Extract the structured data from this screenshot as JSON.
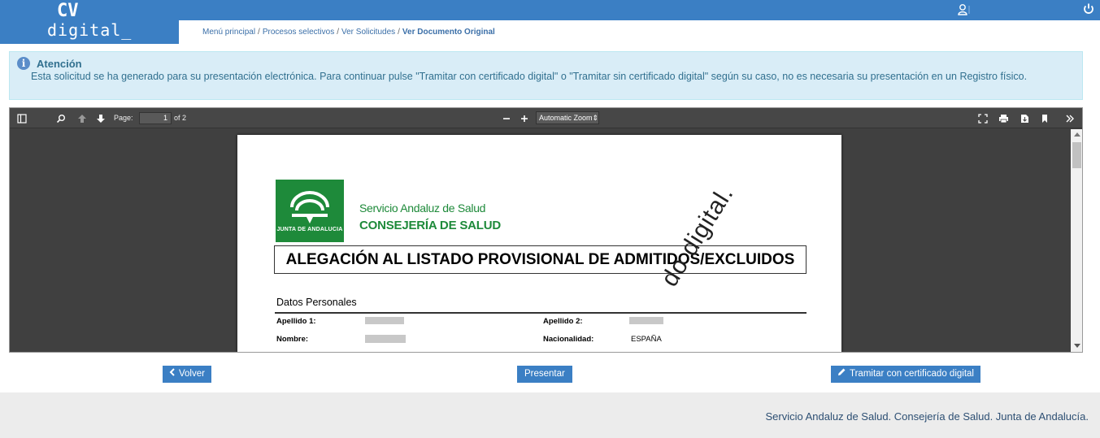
{
  "header": {
    "logo_line1": "CV",
    "logo_line2": "digital_",
    "brand_color": "#3b7fc4"
  },
  "breadcrumb": {
    "items": [
      "Menú principal",
      "Procesos selectivos",
      "Ver Solicitudes"
    ],
    "current": "Ver Documento Original",
    "separator": "/"
  },
  "alert": {
    "title": "Atención",
    "text": "Esta solicitud se ha generado para su presentación electrónica. Para continuar pulse \"Tramitar con certificado digital\" o \"Tramitar sin certificado digital\" según su caso, no es necesaria su presentación en un Registro físico.",
    "background": "#d9edf7"
  },
  "pdf_viewer": {
    "page_label": "Page:",
    "page_value": "1",
    "page_of": "of 2",
    "zoom": "Automatic Zoom",
    "icons": [
      "sidebar-toggle-icon",
      "find-icon",
      "previous-page-icon",
      "next-page-icon",
      "zoom-out-icon",
      "zoom-in-icon",
      "presentation-mode-icon",
      "print-icon",
      "download-icon",
      "bookmark-icon",
      "tools-icon"
    ]
  },
  "document": {
    "org_line1": "Servicio Andaluz de Salud",
    "org_line2": "CONSEJERÍA DE SALUD",
    "logo_caption": "JUNTA DE ANDALUCIA",
    "title": "ALEGACIÓN AL LISTADO PROVISIONAL DE ADMITIDOS/EXCLUIDOS",
    "section": "Datos Personales",
    "fields": {
      "apellido1_label": "Apellido 1:",
      "apellido2_label": "Apellido 2:",
      "nombre_label": "Nombre:",
      "nacionalidad_label": "Nacionalidad:",
      "nacionalidad_value": "ESPAÑA"
    },
    "watermark": "do digital.",
    "accent_color": "#1e8a3a"
  },
  "actions": {
    "back": "Volver",
    "submit": "Presentar",
    "sign": "Tramitar con certificado digital"
  },
  "footer": {
    "text": "Servicio Andaluz de Salud. Consejería de Salud. Junta de Andalucía."
  }
}
